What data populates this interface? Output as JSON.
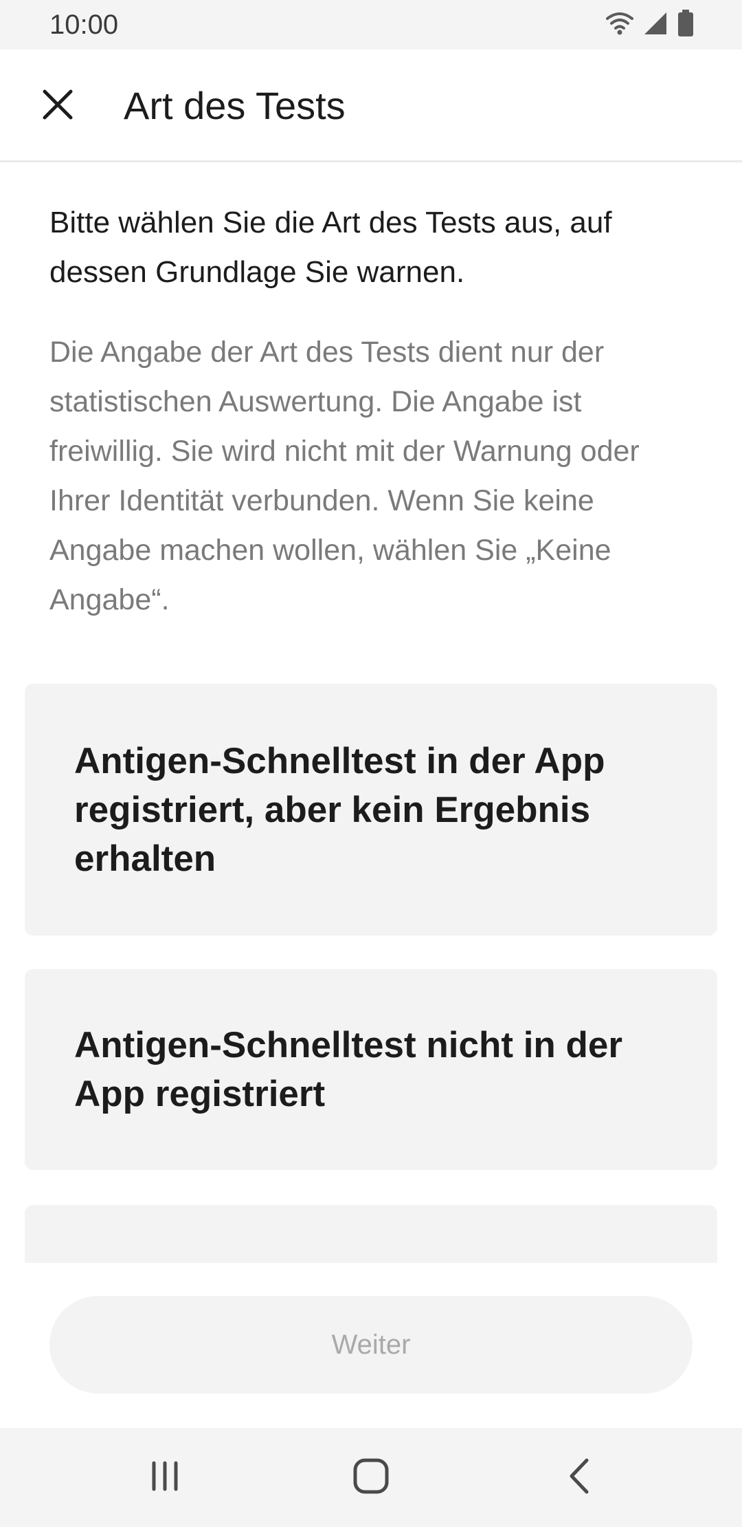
{
  "status_bar": {
    "time": "10:00",
    "icons": [
      "wifi-icon",
      "signal-icon",
      "battery-icon"
    ]
  },
  "header": {
    "close_icon": "close-icon",
    "title": "Art des Tests"
  },
  "content": {
    "intro": "Bitte wählen Sie die Art des Tests aus, auf dessen Grundlage Sie warnen.",
    "note": "Die Angabe der Art des Tests dient nur der statistischen Auswertung. Die Angabe ist freiwillig. Sie wird nicht mit der Warnung oder Ihrer Identität verbunden. Wenn Sie keine Angabe machen wollen, wählen Sie „Keine Angabe“.",
    "options": [
      {
        "label": "Antigen-Schnelltest in der App registriert, aber kein Ergebnis erhalten"
      },
      {
        "label": "Antigen-Schnelltest nicht in der App registriert"
      },
      {
        "label": ""
      }
    ]
  },
  "footer": {
    "next_label": "Weiter",
    "next_enabled": false
  },
  "nav_bar": {
    "icons": [
      "recents-icon",
      "home-icon",
      "back-icon"
    ]
  },
  "colors": {
    "status_bar_bg": "#f4f4f4",
    "card_bg": "#f3f3f3",
    "text_primary": "#1c1c1c",
    "text_secondary": "#7a7a7a",
    "button_disabled_text": "#a9a9a9"
  }
}
